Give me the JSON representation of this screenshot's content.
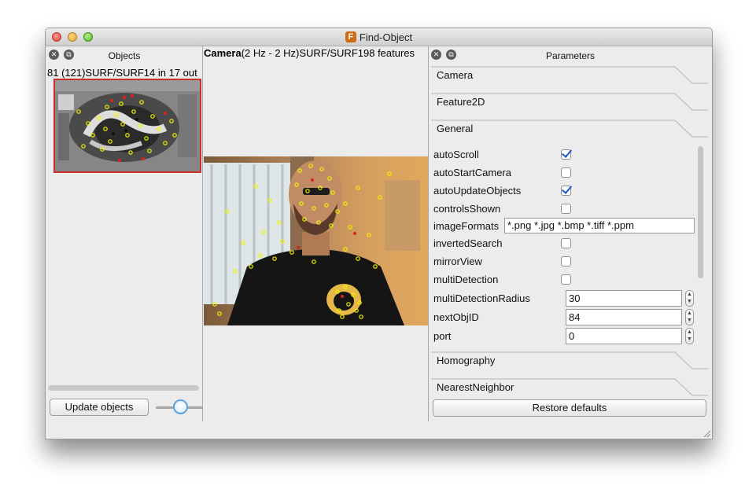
{
  "window": {
    "title": "Find-Object",
    "app_icon_glyph": "F"
  },
  "objects_panel": {
    "title": "Objects",
    "object_label": "81 (121)SURF/SURF14 in 17 out",
    "update_button": "Update objects"
  },
  "camera": {
    "title_bold": "Camera",
    "title_rest": "(2 Hz - 2 Hz)SURF/SURF198 features"
  },
  "parameters": {
    "title": "Parameters",
    "sections": {
      "camera": "Camera",
      "feature2d": "Feature2D",
      "general": "General",
      "homography": "Homography",
      "nearest_neighbor": "NearestNeighbor"
    },
    "rows": {
      "autoScroll": {
        "label": "autoScroll",
        "checked": true
      },
      "autoStartCamera": {
        "label": "autoStartCamera",
        "checked": false
      },
      "autoUpdateObjects": {
        "label": "autoUpdateObjects",
        "checked": true
      },
      "controlsShown": {
        "label": "controlsShown",
        "checked": false
      },
      "imageFormats": {
        "label": "imageFormats",
        "value": "*.png *.jpg *.bmp *.tiff *.ppm"
      },
      "invertedSearch": {
        "label": "invertedSearch",
        "checked": false
      },
      "mirrorView": {
        "label": "mirrorView",
        "checked": false
      },
      "multiDetection": {
        "label": "multiDetection",
        "checked": false
      },
      "multiDetectionRadius": {
        "label": "multiDetectionRadius",
        "value": "30"
      },
      "nextObjID": {
        "label": "nextObjID",
        "value": "84"
      },
      "port": {
        "label": "port",
        "value": "0"
      }
    },
    "restore_button": "Restore defaults"
  },
  "colors": {
    "keypoint": "#f2f200",
    "matched": "#e02020",
    "checkmark": "#1e56c8",
    "slider_focus": "#5aa2e0"
  }
}
